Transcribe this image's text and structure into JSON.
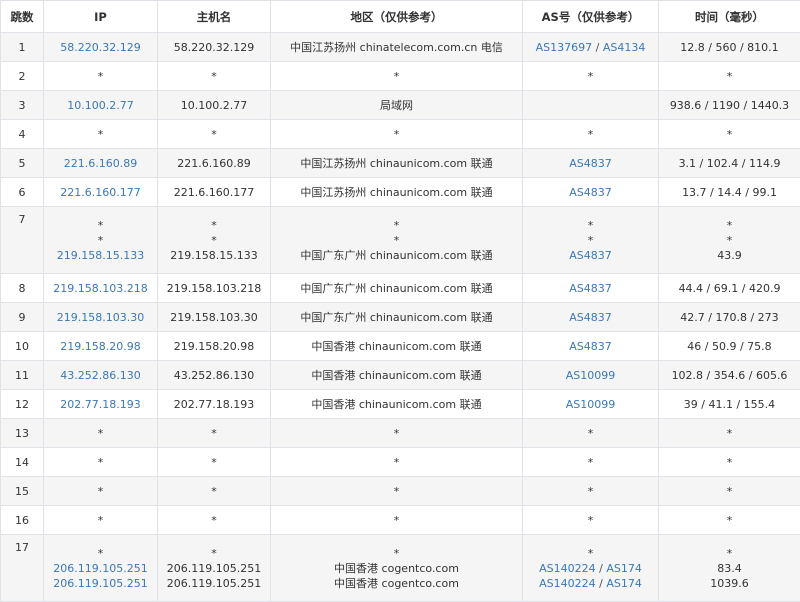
{
  "headers": {
    "hop": "跳数",
    "ip": "IP",
    "host": "主机名",
    "region": "地区（仅供参考）",
    "as": "AS号（仅供参考）",
    "time": "时间（毫秒）"
  },
  "rows": [
    {
      "hop": "1",
      "entries": [
        {
          "ip": "58.220.32.129",
          "host": "58.220.32.129",
          "region": "中国江苏扬州 chinatelecom.com.cn 电信",
          "as": [
            "AS137697",
            "AS4134"
          ],
          "time": "12.8 / 560 / 810.1"
        }
      ]
    },
    {
      "hop": "2",
      "entries": [
        {
          "ip": "*",
          "host": "*",
          "region": "*",
          "as": [
            "*"
          ],
          "time": "*"
        }
      ]
    },
    {
      "hop": "3",
      "entries": [
        {
          "ip": "10.100.2.77",
          "host": "10.100.2.77",
          "region": "局域网",
          "as": [],
          "time": "938.6 / 1190 / 1440.3"
        }
      ]
    },
    {
      "hop": "4",
      "entries": [
        {
          "ip": "*",
          "host": "*",
          "region": "*",
          "as": [
            "*"
          ],
          "time": "*"
        }
      ]
    },
    {
      "hop": "5",
      "entries": [
        {
          "ip": "221.6.160.89",
          "host": "221.6.160.89",
          "region": "中国江苏扬州 chinaunicom.com 联通",
          "as": [
            "AS4837"
          ],
          "time": "3.1 / 102.4 / 114.9"
        }
      ]
    },
    {
      "hop": "6",
      "entries": [
        {
          "ip": "221.6.160.177",
          "host": "221.6.160.177",
          "region": "中国江苏扬州 chinaunicom.com 联通",
          "as": [
            "AS4837"
          ],
          "time": "13.7 / 14.4 / 99.1"
        }
      ]
    },
    {
      "hop": "7",
      "entries": [
        {
          "ip": "*",
          "host": "*",
          "region": "*",
          "as": [
            "*"
          ],
          "time": "*"
        },
        {
          "ip": "*",
          "host": "*",
          "region": "*",
          "as": [
            "*"
          ],
          "time": "*"
        },
        {
          "ip": "219.158.15.133",
          "host": "219.158.15.133",
          "region": "中国广东广州 chinaunicom.com 联通",
          "as": [
            "AS4837"
          ],
          "time": "43.9"
        }
      ]
    },
    {
      "hop": "8",
      "entries": [
        {
          "ip": "219.158.103.218",
          "host": "219.158.103.218",
          "region": "中国广东广州 chinaunicom.com 联通",
          "as": [
            "AS4837"
          ],
          "time": "44.4 / 69.1 / 420.9"
        }
      ]
    },
    {
      "hop": "9",
      "entries": [
        {
          "ip": "219.158.103.30",
          "host": "219.158.103.30",
          "region": "中国广东广州 chinaunicom.com 联通",
          "as": [
            "AS4837"
          ],
          "time": "42.7 / 170.8 / 273"
        }
      ]
    },
    {
      "hop": "10",
      "entries": [
        {
          "ip": "219.158.20.98",
          "host": "219.158.20.98",
          "region": "中国香港 chinaunicom.com 联通",
          "as": [
            "AS4837"
          ],
          "time": "46 / 50.9 / 75.8"
        }
      ]
    },
    {
      "hop": "11",
      "entries": [
        {
          "ip": "43.252.86.130",
          "host": "43.252.86.130",
          "region": "中国香港 chinaunicom.com 联通",
          "as": [
            "AS10099"
          ],
          "time": "102.8 / 354.6 / 605.6"
        }
      ]
    },
    {
      "hop": "12",
      "entries": [
        {
          "ip": "202.77.18.193",
          "host": "202.77.18.193",
          "region": "中国香港 chinaunicom.com 联通",
          "as": [
            "AS10099"
          ],
          "time": "39 / 41.1 / 155.4"
        }
      ]
    },
    {
      "hop": "13",
      "entries": [
        {
          "ip": "*",
          "host": "*",
          "region": "*",
          "as": [
            "*"
          ],
          "time": "*"
        }
      ]
    },
    {
      "hop": "14",
      "entries": [
        {
          "ip": "*",
          "host": "*",
          "region": "*",
          "as": [
            "*"
          ],
          "time": "*"
        }
      ]
    },
    {
      "hop": "15",
      "entries": [
        {
          "ip": "*",
          "host": "*",
          "region": "*",
          "as": [
            "*"
          ],
          "time": "*"
        }
      ]
    },
    {
      "hop": "16",
      "entries": [
        {
          "ip": "*",
          "host": "*",
          "region": "*",
          "as": [
            "*"
          ],
          "time": "*"
        }
      ]
    },
    {
      "hop": "17",
      "entries": [
        {
          "ip": "*",
          "host": "*",
          "region": "*",
          "as": [
            "*"
          ],
          "time": "*"
        },
        {
          "ip": "206.119.105.251",
          "host": "206.119.105.251",
          "region": "中国香港 cogentco.com",
          "as": [
            "AS140224",
            "AS174"
          ],
          "time": "83.4"
        },
        {
          "ip": "206.119.105.251",
          "host": "206.119.105.251",
          "region": "中国香港 cogentco.com",
          "as": [
            "AS140224",
            "AS174"
          ],
          "time": "1039.6"
        }
      ]
    }
  ]
}
